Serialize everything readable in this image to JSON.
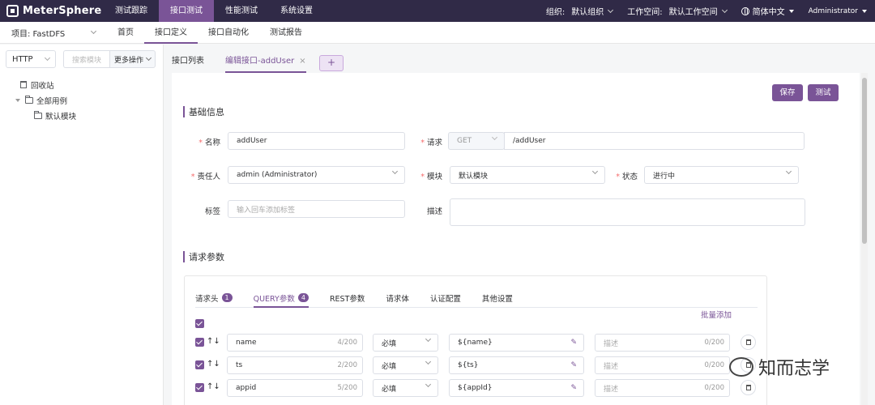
{
  "app": {
    "logo": "MeterSphere"
  },
  "topnav": {
    "items": [
      "测试跟踪",
      "接口测试",
      "性能测试",
      "系统设置"
    ]
  },
  "topright": {
    "org_label": "组织:",
    "org_value": "默认组织",
    "ws_label": "工作空间:",
    "ws_value": "默认工作空间",
    "lang": "简体中文",
    "user": "Administrator"
  },
  "secbar": {
    "project": "项目: FastDFS",
    "items": [
      "首页",
      "接口定义",
      "接口自动化",
      "测试报告"
    ]
  },
  "left": {
    "protocol": "HTTP",
    "search_placeholder": "搜索模块",
    "more": "更多操作",
    "recycle": "回收站",
    "all_cases": "全部用例",
    "default_module": "默认模块"
  },
  "tabs": {
    "list": "接口列表",
    "edit": "编辑接口-addUser",
    "close": "×",
    "add": "+"
  },
  "buttons": {
    "save": "保存",
    "test": "测试"
  },
  "basic": {
    "title": "基础信息",
    "name_label": "名称",
    "name_value": "addUser",
    "request_label": "请求",
    "method": "GET",
    "path": "/addUser",
    "owner_label": "责任人",
    "owner_value": "admin (Administrator)",
    "module_label": "模块",
    "module_value": "默认模块",
    "status_label": "状态",
    "status_value": "进行中",
    "tag_label": "标签",
    "tag_placeholder": "输入回车添加标签",
    "desc_label": "描述"
  },
  "params": {
    "title": "请求参数",
    "tabs": [
      {
        "label": "请求头",
        "badge": "1"
      },
      {
        "label": "QUERY参数",
        "badge": "4"
      },
      {
        "label": "REST参数",
        "badge": ""
      },
      {
        "label": "请求体",
        "badge": ""
      },
      {
        "label": "认证配置",
        "badge": ""
      },
      {
        "label": "其他设置",
        "badge": ""
      }
    ],
    "batch_add": "批量添加",
    "rows": [
      {
        "name": "name",
        "count": "4/200",
        "required": "必填",
        "value": "${name}",
        "desc_placeholder": "描述",
        "desc_count": "0/200"
      },
      {
        "name": "ts",
        "count": "2/200",
        "required": "必填",
        "value": "${ts}",
        "desc_placeholder": "描述",
        "desc_count": "0/200"
      },
      {
        "name": "appid",
        "count": "5/200",
        "required": "必填",
        "value": "${appId}",
        "desc_placeholder": "描述",
        "desc_count": "0/200"
      }
    ]
  },
  "watermark": "知而志学"
}
